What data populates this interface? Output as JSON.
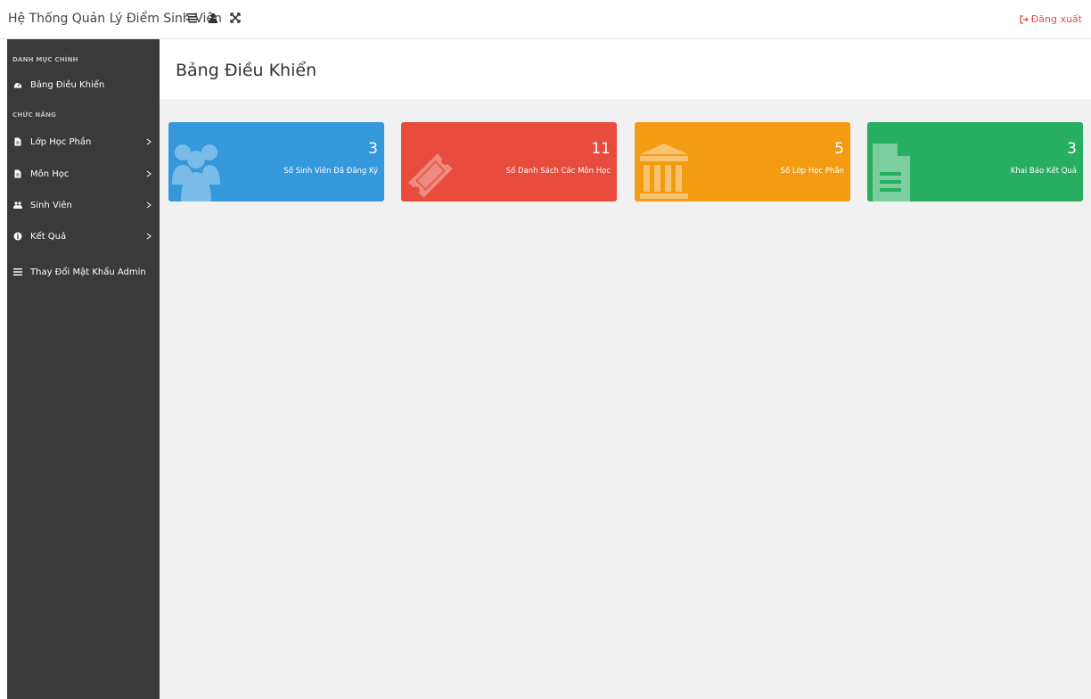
{
  "header": {
    "brand": "Hệ Thống Quản Lý Điểm Sinh Viên",
    "icons": [
      "list-icon",
      "user-icon",
      "expand-icon"
    ],
    "logout_label": "Đăng xuất"
  },
  "sidebar": {
    "sections": [
      {
        "title": "DANH MỤC CHÍNH"
      },
      {
        "title": "CHỨC NĂNG"
      }
    ],
    "items": [
      {
        "label": "Bảng Điều Khiển",
        "icon": "dashboard-icon"
      },
      {
        "label": "Lớp Học Phần",
        "icon": "file-icon"
      },
      {
        "label": "Môn Học",
        "icon": "file-icon"
      },
      {
        "label": "Sinh Viên",
        "icon": "users-icon"
      },
      {
        "label": "Kết Quả",
        "icon": "info-icon"
      },
      {
        "label": "Thay Đổi Mật Khẩu Admin",
        "icon": "list-icon"
      }
    ]
  },
  "page": {
    "title": "Bảng Điều Khiển"
  },
  "cards": [
    {
      "count": "3",
      "label": "Số Sinh Viên Đã Đăng Ký",
      "color": "#3498db",
      "icon": "users-icon"
    },
    {
      "count": "11",
      "label": "Số Danh Sách Các Môn Học",
      "color": "#e74c3c",
      "icon": "ticket-icon"
    },
    {
      "count": "5",
      "label": "Số Lớp Học Phần",
      "color": "#f39c12",
      "icon": "institution-icon"
    },
    {
      "count": "3",
      "label": "Khai Báo Kết Quả",
      "color": "#27ae60",
      "icon": "document-icon"
    }
  ],
  "colors": {
    "sidebar_bg": "#3a3a3a",
    "main_bg": "#f1f1f1",
    "logout": "#e74c3c"
  }
}
